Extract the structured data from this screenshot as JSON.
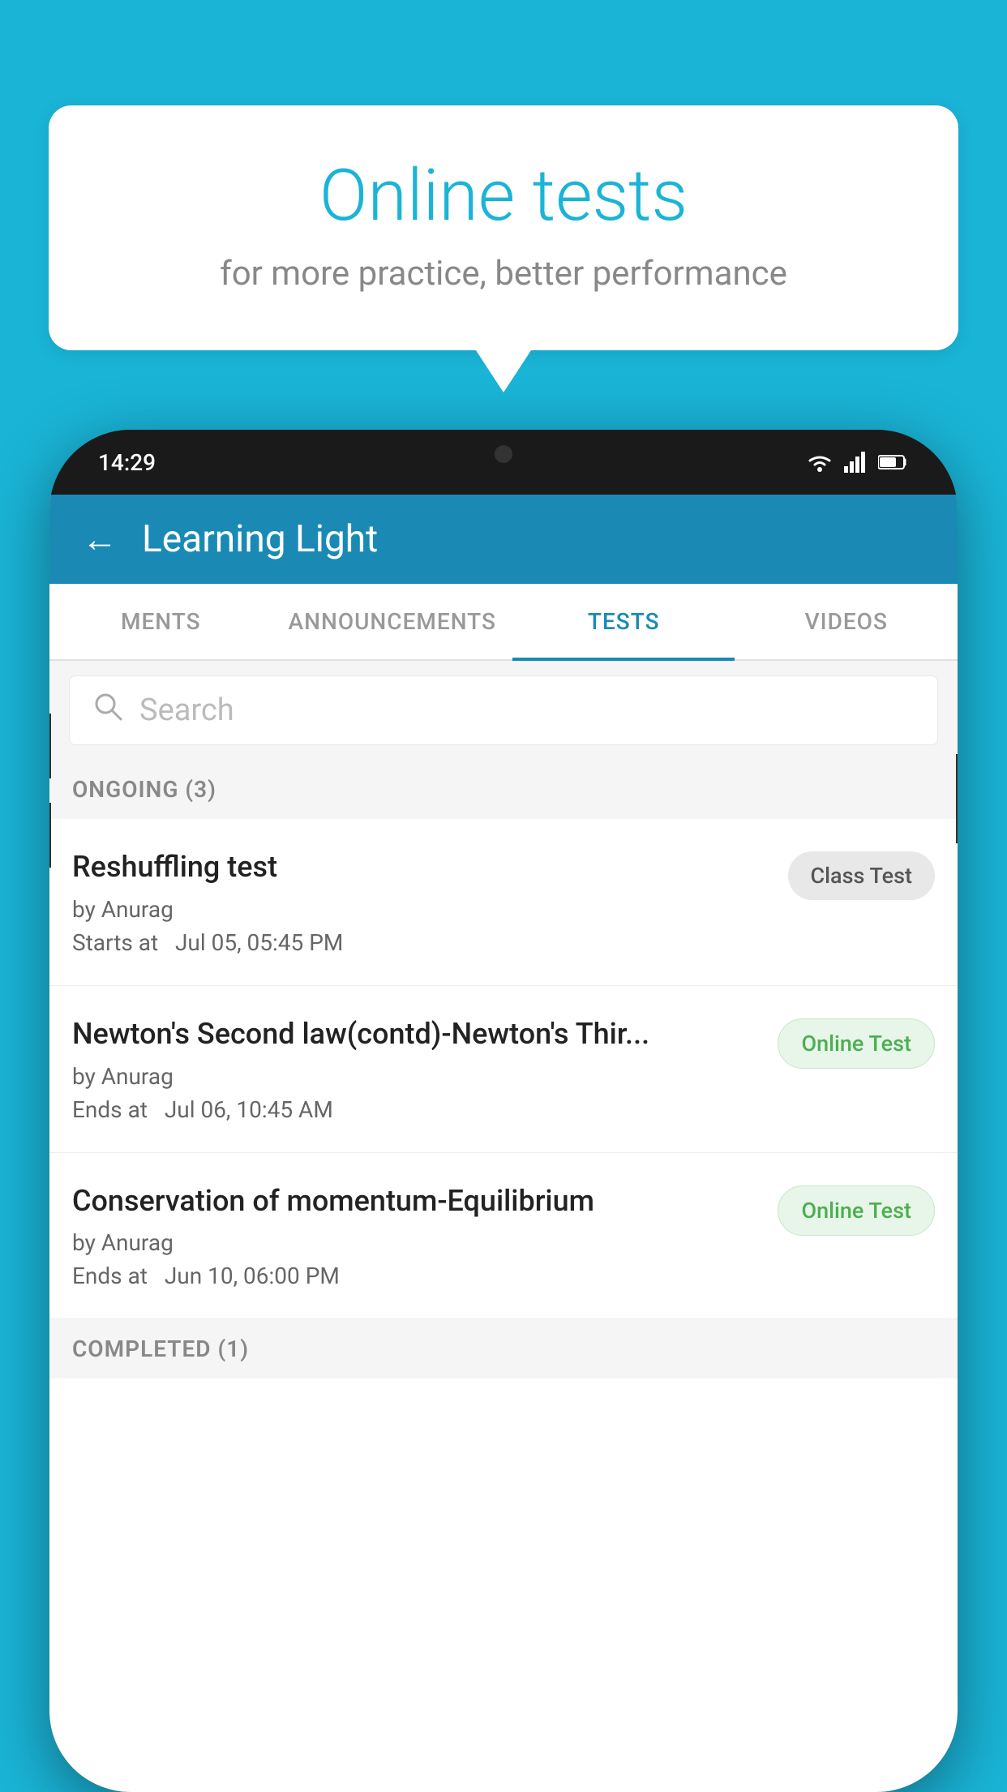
{
  "background_color": "#1ab4d7",
  "speech_bubble": {
    "title": "Online tests",
    "subtitle": "for more practice, better performance"
  },
  "phone": {
    "status_bar": {
      "time": "14:29"
    },
    "app_header": {
      "title": "Learning Light",
      "back_label": "←"
    },
    "tabs": [
      {
        "label": "MENTS",
        "active": false
      },
      {
        "label": "ANNOUNCEMENTS",
        "active": false
      },
      {
        "label": "TESTS",
        "active": true
      },
      {
        "label": "VIDEOS",
        "active": false
      }
    ],
    "search": {
      "placeholder": "Search"
    },
    "sections": [
      {
        "label": "ONGOING (3)",
        "tests": [
          {
            "name": "Reshuffling test",
            "author": "by Anurag",
            "time_label": "Starts at",
            "time": "Jul 05, 05:45 PM",
            "badge": "Class Test",
            "badge_type": "class"
          },
          {
            "name": "Newton's Second law(contd)-Newton's Thir...",
            "author": "by Anurag",
            "time_label": "Ends at",
            "time": "Jul 06, 10:45 AM",
            "badge": "Online Test",
            "badge_type": "online"
          },
          {
            "name": "Conservation of momentum-Equilibrium",
            "author": "by Anurag",
            "time_label": "Ends at",
            "time": "Jun 10, 06:00 PM",
            "badge": "Online Test",
            "badge_type": "online"
          }
        ]
      }
    ],
    "completed_label": "COMPLETED (1)"
  }
}
